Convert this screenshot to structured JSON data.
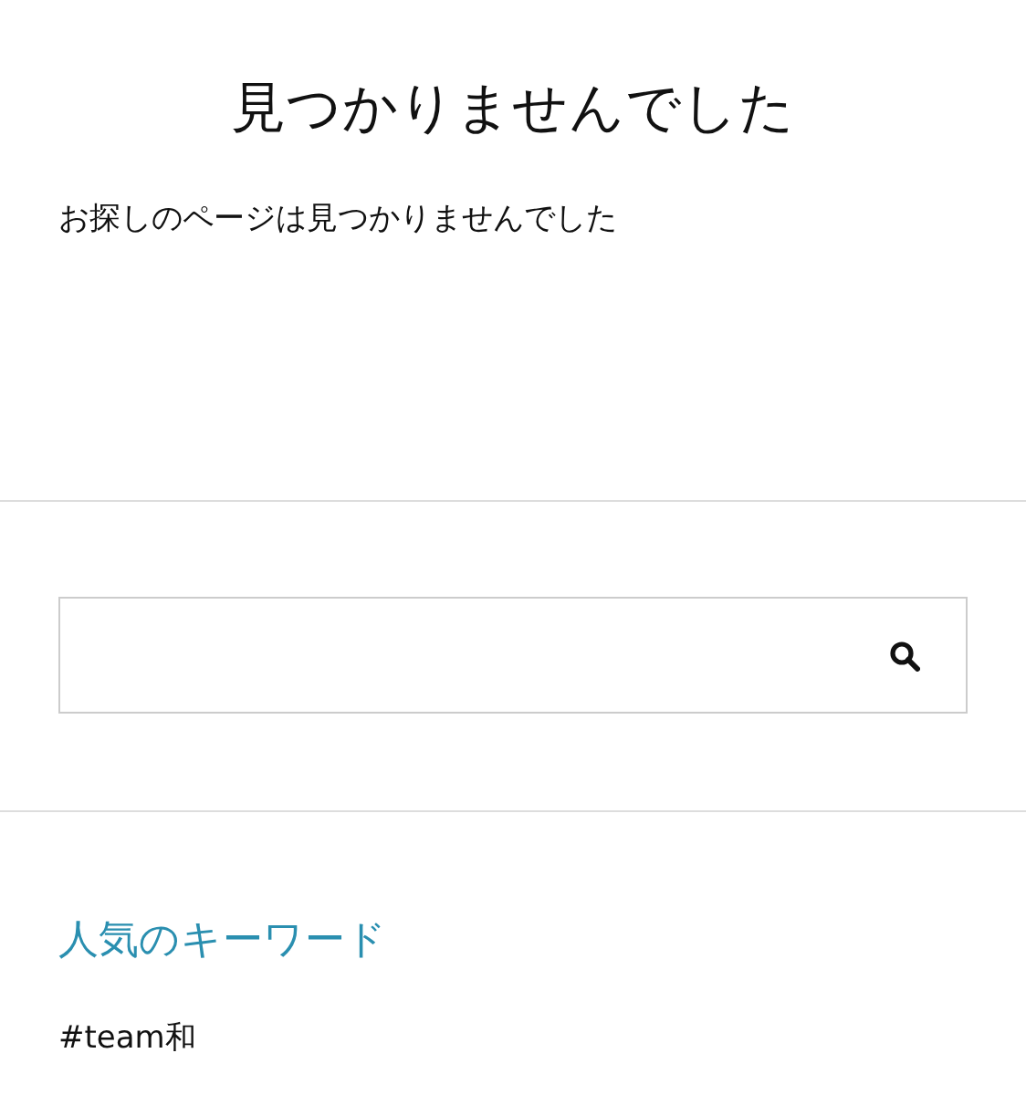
{
  "title": "見つかりませんでした",
  "message": "お探しのページは見つかりませんでした",
  "keywords": {
    "heading": "人気のキーワード",
    "items": [
      "#team和"
    ]
  }
}
